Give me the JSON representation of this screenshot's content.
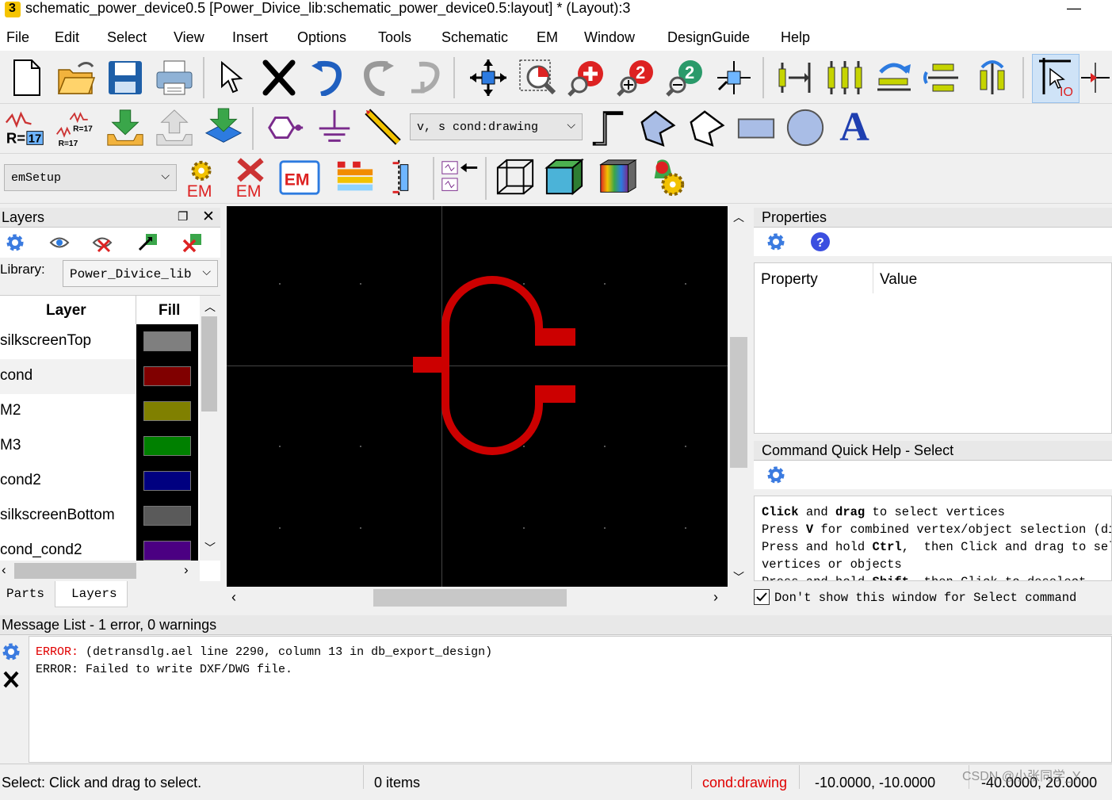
{
  "window": {
    "title": "schematic_power_device0.5 [Power_Divice_lib:schematic_power_device0.5:layout] * (Layout):3",
    "app_icon_letter": "3",
    "minimize_glyph": "—"
  },
  "menu": [
    "File",
    "Edit",
    "Select",
    "View",
    "Insert",
    "Options",
    "Tools",
    "Schematic",
    "EM",
    "Window",
    "DesignGuide",
    "Help"
  ],
  "toolbar": {
    "layer_combo_value": "v, s  cond:drawing",
    "em_setup_value": "emSetup",
    "em_label": "EM",
    "em_box_label": "EM",
    "text_tool_glyph": "A",
    "r17_label": "R=17"
  },
  "layers_panel": {
    "title": "Layers",
    "library_label": "Library:",
    "library_value": "Power_Divice_lib",
    "col_layer": "Layer",
    "col_fill": "Fill",
    "rows": [
      {
        "name": "silkscreenTop",
        "color": "#7f7f7f",
        "selected": false
      },
      {
        "name": "cond",
        "color": "#800000",
        "selected": true
      },
      {
        "name": "M2",
        "color": "#808000",
        "selected": false
      },
      {
        "name": "M3",
        "color": "#008000",
        "selected": false
      },
      {
        "name": "cond2",
        "color": "#000080",
        "selected": false
      },
      {
        "name": "silkscreenBottom",
        "color": "#5a5a5a",
        "selected": false
      },
      {
        "name": "cond_cond2",
        "color": "#4b0082",
        "selected": false
      }
    ],
    "tabs": [
      "Parts",
      "Layers"
    ]
  },
  "canvas": {
    "background": "#000000",
    "shape_color": "#cc0000"
  },
  "properties_panel": {
    "title": "Properties",
    "col_property": "Property",
    "col_value": "Value"
  },
  "quick_help": {
    "title": "Command Quick Help - Select",
    "lines": [
      [
        {
          "t": "Click",
          "b": true
        },
        {
          "t": " and ",
          "b": false
        },
        {
          "t": "drag",
          "b": true
        },
        {
          "t": " to select vertices",
          "b": false
        }
      ],
      [
        {
          "t": "Press ",
          "b": false
        },
        {
          "t": "V",
          "b": true
        },
        {
          "t": " for combined vertex/object selection (dis",
          "b": false
        }
      ],
      [
        {
          "t": "Press and hold ",
          "b": false
        },
        {
          "t": "Ctrl",
          "b": true
        },
        {
          "t": ",  then Click and drag to selec",
          "b": false
        }
      ],
      [
        {
          "t": "vertices or objects",
          "b": false
        }
      ],
      [
        {
          "t": "Press and hold ",
          "b": false
        },
        {
          "t": "Shift",
          "b": true
        },
        {
          "t": ", then Click to deselect",
          "b": false
        }
      ]
    ],
    "checkbox_label": "Don't show this window for Select command",
    "checkbox_checked": true
  },
  "message_list": {
    "title": "Message List - 1 error, 0 warnings",
    "line1_prefix": "ERROR:",
    "line1_text": " (detransdlg.ael line 2290, column 13 in db_export_design)",
    "line2_text": "ERROR: Failed to write DXF/DWG file.",
    "error_color": "#e00000"
  },
  "status_bar": {
    "prompt": "Select: Click and drag to select.",
    "items": "0 items",
    "layer": "cond:drawing",
    "coords1": "-10.0000, -10.0000",
    "coords2": "-40.0000, 20.0000",
    "watermark": "CSDN @小张同学_Y"
  }
}
